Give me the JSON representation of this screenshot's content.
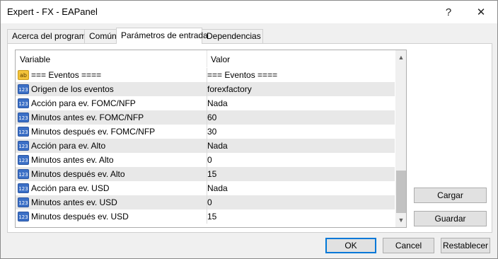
{
  "window": {
    "title": "Expert - FX - EAPanel",
    "help_label": "?",
    "close_label": "✕"
  },
  "tabs": [
    {
      "label": "Acerca del programa"
    },
    {
      "label": "Común"
    },
    {
      "label": "Parámetros de entrada"
    },
    {
      "label": "Dependencias"
    }
  ],
  "grid": {
    "col_variable": "Variable",
    "col_valor": "Valor",
    "rows": [
      {
        "icon": "ab",
        "name": "=== Eventos ====",
        "value": "=== Eventos ===="
      },
      {
        "icon": "123",
        "name": "Origen de los eventos",
        "value": "forexfactory"
      },
      {
        "icon": "123",
        "name": "Acción para ev. FOMC/NFP",
        "value": "Nada"
      },
      {
        "icon": "123",
        "name": "Minutos antes ev. FOMC/NFP",
        "value": "60"
      },
      {
        "icon": "123",
        "name": "Minutos después ev. FOMC/NFP",
        "value": "30"
      },
      {
        "icon": "123",
        "name": "Acción para ev. Alto",
        "value": "Nada"
      },
      {
        "icon": "123",
        "name": "Minutos antes ev. Alto",
        "value": "0"
      },
      {
        "icon": "123",
        "name": "Minutos después ev. Alto",
        "value": "15"
      },
      {
        "icon": "123",
        "name": "Acción para ev. USD",
        "value": "Nada"
      },
      {
        "icon": "123",
        "name": "Minutos antes ev. USD",
        "value": "0"
      },
      {
        "icon": "123",
        "name": "Minutos después ev. USD",
        "value": "15"
      }
    ]
  },
  "side_buttons": {
    "cargar": "Cargar",
    "guardar": "Guardar"
  },
  "footer": {
    "ok": "OK",
    "cancel": "Cancel",
    "reset": "Restablecer"
  }
}
